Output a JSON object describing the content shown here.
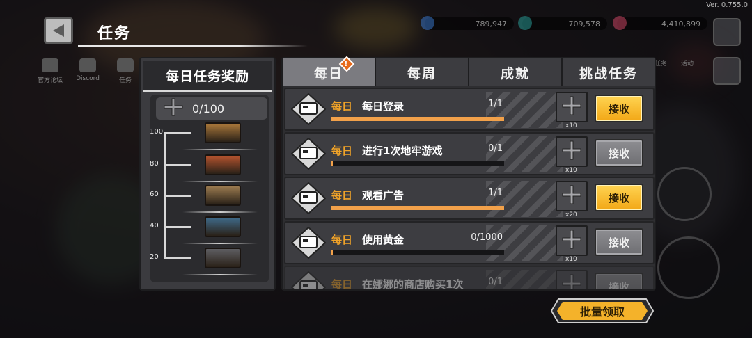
{
  "header": {
    "title": "任务",
    "version": "Ver. 0.755.0"
  },
  "currencies": [
    {
      "name": "blue-gem",
      "value": "789,947",
      "color": "#3a7bd5"
    },
    {
      "name": "teal-gem",
      "value": "709,578",
      "color": "#2aa6a0"
    },
    {
      "name": "red-gem",
      "value": "4,410,899",
      "color": "#d94a6a"
    }
  ],
  "left_icons": [
    {
      "label": "官方论坛"
    },
    {
      "label": "Discord"
    },
    {
      "label": "任务"
    }
  ],
  "right_icons": [
    {
      "label": "任务"
    },
    {
      "label": "活动"
    }
  ],
  "reward_panel": {
    "title": "每日任务奖励",
    "points": "0/100",
    "milestones": [
      {
        "value": "100",
        "color": "#a9773a"
      },
      {
        "value": "80",
        "color": "#b4532e"
      },
      {
        "value": "60",
        "color": "#9a7a4f"
      },
      {
        "value": "40",
        "color": "#3f6a8a"
      },
      {
        "value": "20",
        "color": "#5e5e62"
      }
    ]
  },
  "tabs": [
    {
      "label": "每日",
      "active": true,
      "alert": "!"
    },
    {
      "label": "每周",
      "active": false
    },
    {
      "label": "成就",
      "active": false
    },
    {
      "label": "挑战任务",
      "active": false
    }
  ],
  "tasks": [
    {
      "type": "每日",
      "name": "每日登录",
      "count": "1/1",
      "progress": 1.0,
      "reward_qty": "x10",
      "claim": "接收",
      "claimable": true
    },
    {
      "type": "每日",
      "name": "进行1次地牢游戏",
      "count": "0/1",
      "progress": 0.0,
      "reward_qty": "x10",
      "claim": "接收",
      "claimable": false
    },
    {
      "type": "每日",
      "name": "观看广告",
      "count": "1/1",
      "progress": 1.0,
      "reward_qty": "x20",
      "claim": "接收",
      "claimable": true
    },
    {
      "type": "每日",
      "name": "使用黄金",
      "count": "0/1000",
      "progress": 0.0,
      "reward_qty": "x10",
      "claim": "接收",
      "claimable": false
    },
    {
      "type": "每日",
      "name": "在娜娜的商店购买1次",
      "count": "0/1",
      "progress": 0.0,
      "reward_qty": "",
      "claim": "接收",
      "claimable": false
    }
  ],
  "batch_button": "批量领取",
  "colors": {
    "accent": "#f2a428",
    "progress": "#f2a14a",
    "claim_on": "#ffd452",
    "claim_off": "#7e7e82"
  }
}
